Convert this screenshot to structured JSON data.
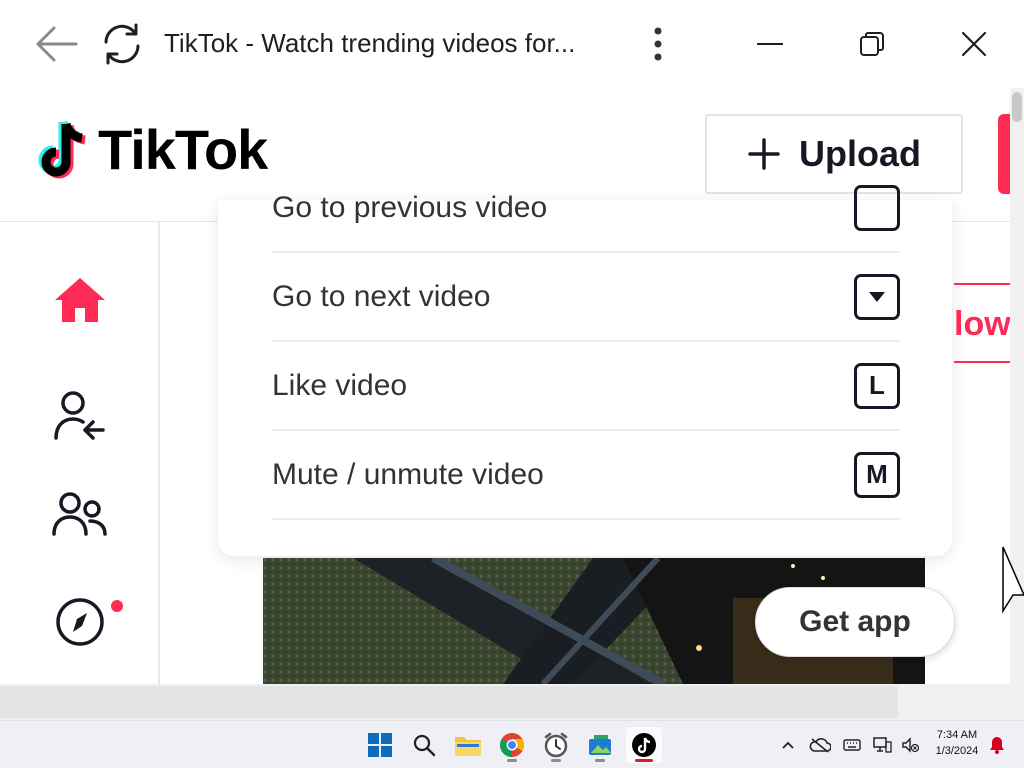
{
  "window": {
    "title": "TikTok - Watch trending videos for..."
  },
  "header": {
    "logo_text": "TikTok",
    "upload_label": "Upload"
  },
  "shortcuts": [
    {
      "label": "Go to previous video",
      "key": ""
    },
    {
      "label": "Go to next video",
      "key": "▼"
    },
    {
      "label": "Like video",
      "key": "L"
    },
    {
      "label": "Mute / unmute video",
      "key": "M"
    }
  ],
  "follow_fragment": "low",
  "get_app_label": "Get app",
  "taskbar": {
    "time": "7:34 AM",
    "date": "1/3/2024"
  },
  "colors": {
    "brand_pink": "#fe2c55",
    "brand_cyan": "#25f4ee"
  }
}
